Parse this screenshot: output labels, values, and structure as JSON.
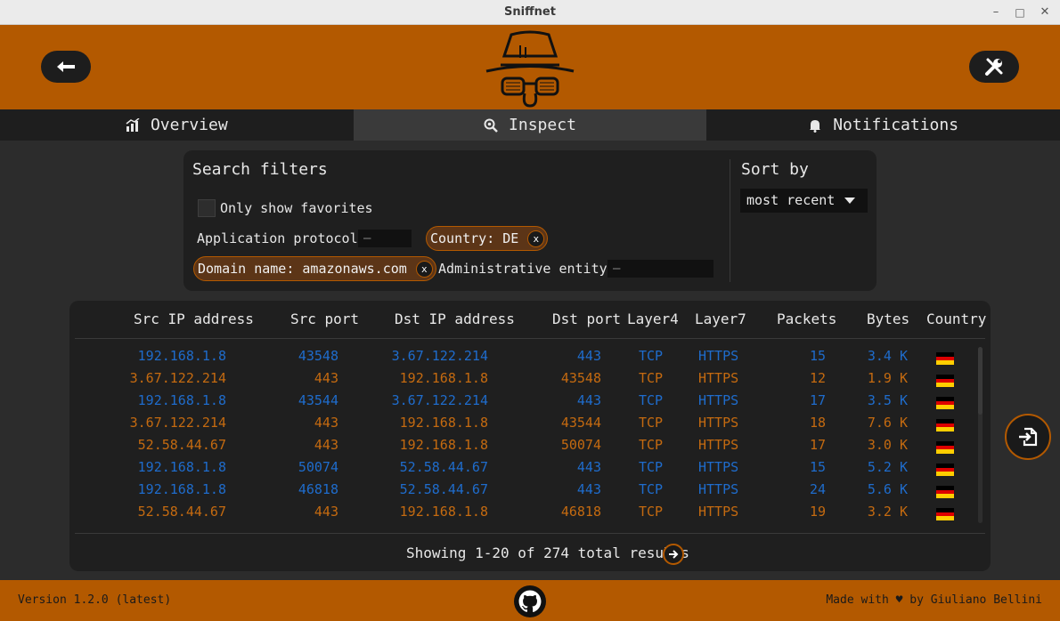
{
  "window": {
    "title": "Sniffnet",
    "minimize": "–",
    "maximize": "□",
    "close": "✕"
  },
  "header": {
    "back_icon": "arrow-left-icon",
    "settings_icon": "wrench-screwdriver-icon",
    "logo": "hat-glasses-logo"
  },
  "tabs": [
    {
      "label": "Overview",
      "icon": "bar-chart-icon",
      "active": false
    },
    {
      "label": "Inspect",
      "icon": "magnifier-icon",
      "active": true
    },
    {
      "label": "Notifications",
      "icon": "bell-icon",
      "active": false
    }
  ],
  "filters": {
    "title": "Search filters",
    "favorites_label": "Only show favorites",
    "app_protocol_label": "Application protocol:",
    "app_protocol_value": "–",
    "country_chip": "Country: DE",
    "domain_chip": "Domain name: amazonaws.com",
    "chip_close": "x",
    "admin_entity_label": "Administrative entity:",
    "admin_entity_value": "–",
    "sort_title": "Sort by",
    "sort_value": "most recent"
  },
  "table": {
    "columns": [
      "Src IP address",
      "Src port",
      "Dst IP address",
      "Dst port",
      "Layer4",
      "Layer7",
      "Packets",
      "Bytes",
      "Country"
    ],
    "rows": [
      {
        "src": "192.168.1.8",
        "sport": "43548",
        "dst": "3.67.122.214",
        "dport": "443",
        "l4": "TCP",
        "l7": "HTTPS",
        "packets": "15",
        "bytes": "3.4 K",
        "country": "DE",
        "dir": "out"
      },
      {
        "src": "3.67.122.214",
        "sport": "443",
        "dst": "192.168.1.8",
        "dport": "43548",
        "l4": "TCP",
        "l7": "HTTPS",
        "packets": "12",
        "bytes": "1.9 K",
        "country": "DE",
        "dir": "in"
      },
      {
        "src": "192.168.1.8",
        "sport": "43544",
        "dst": "3.67.122.214",
        "dport": "443",
        "l4": "TCP",
        "l7": "HTTPS",
        "packets": "17",
        "bytes": "3.5 K",
        "country": "DE",
        "dir": "out"
      },
      {
        "src": "3.67.122.214",
        "sport": "443",
        "dst": "192.168.1.8",
        "dport": "43544",
        "l4": "TCP",
        "l7": "HTTPS",
        "packets": "18",
        "bytes": "7.6 K",
        "country": "DE",
        "dir": "in"
      },
      {
        "src": "52.58.44.67",
        "sport": "443",
        "dst": "192.168.1.8",
        "dport": "50074",
        "l4": "TCP",
        "l7": "HTTPS",
        "packets": "17",
        "bytes": "3.0 K",
        "country": "DE",
        "dir": "in"
      },
      {
        "src": "192.168.1.8",
        "sport": "50074",
        "dst": "52.58.44.67",
        "dport": "443",
        "l4": "TCP",
        "l7": "HTTPS",
        "packets": "15",
        "bytes": "5.2 K",
        "country": "DE",
        "dir": "out"
      },
      {
        "src": "192.168.1.8",
        "sport": "46818",
        "dst": "52.58.44.67",
        "dport": "443",
        "l4": "TCP",
        "l7": "HTTPS",
        "packets": "24",
        "bytes": "5.6 K",
        "country": "DE",
        "dir": "out"
      },
      {
        "src": "52.58.44.67",
        "sport": "443",
        "dst": "192.168.1.8",
        "dport": "46818",
        "l4": "TCP",
        "l7": "HTTPS",
        "packets": "19",
        "bytes": "3.2 K",
        "country": "DE",
        "dir": "in"
      }
    ],
    "results_text": "Showing 1-20 of 274 total results",
    "next_icon": "arrow-right-circle-icon"
  },
  "export_icon": "file-import-icon",
  "footer": {
    "version": "Version 1.2.0 (latest)",
    "made_with": "Made with ♥ by Giuliano Bellini",
    "github_icon": "github-icon"
  },
  "colors": {
    "accent": "#b35900",
    "outgoing": "#1f6ccc",
    "incoming": "#c46a10",
    "panel": "#1f1f1f",
    "background": "#2c2c2c"
  }
}
